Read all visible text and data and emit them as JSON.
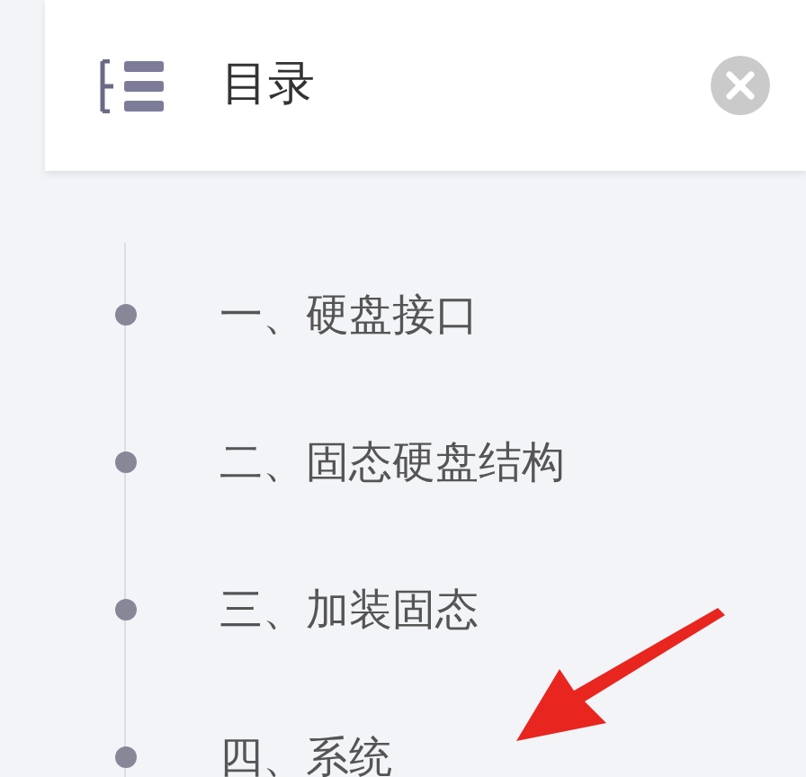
{
  "panel": {
    "title": "目录"
  },
  "items": [
    {
      "label": "一、硬盘接口"
    },
    {
      "label": "二、固态硬盘结构"
    },
    {
      "label": "三、加装固态"
    },
    {
      "label": "四、系统"
    }
  ]
}
